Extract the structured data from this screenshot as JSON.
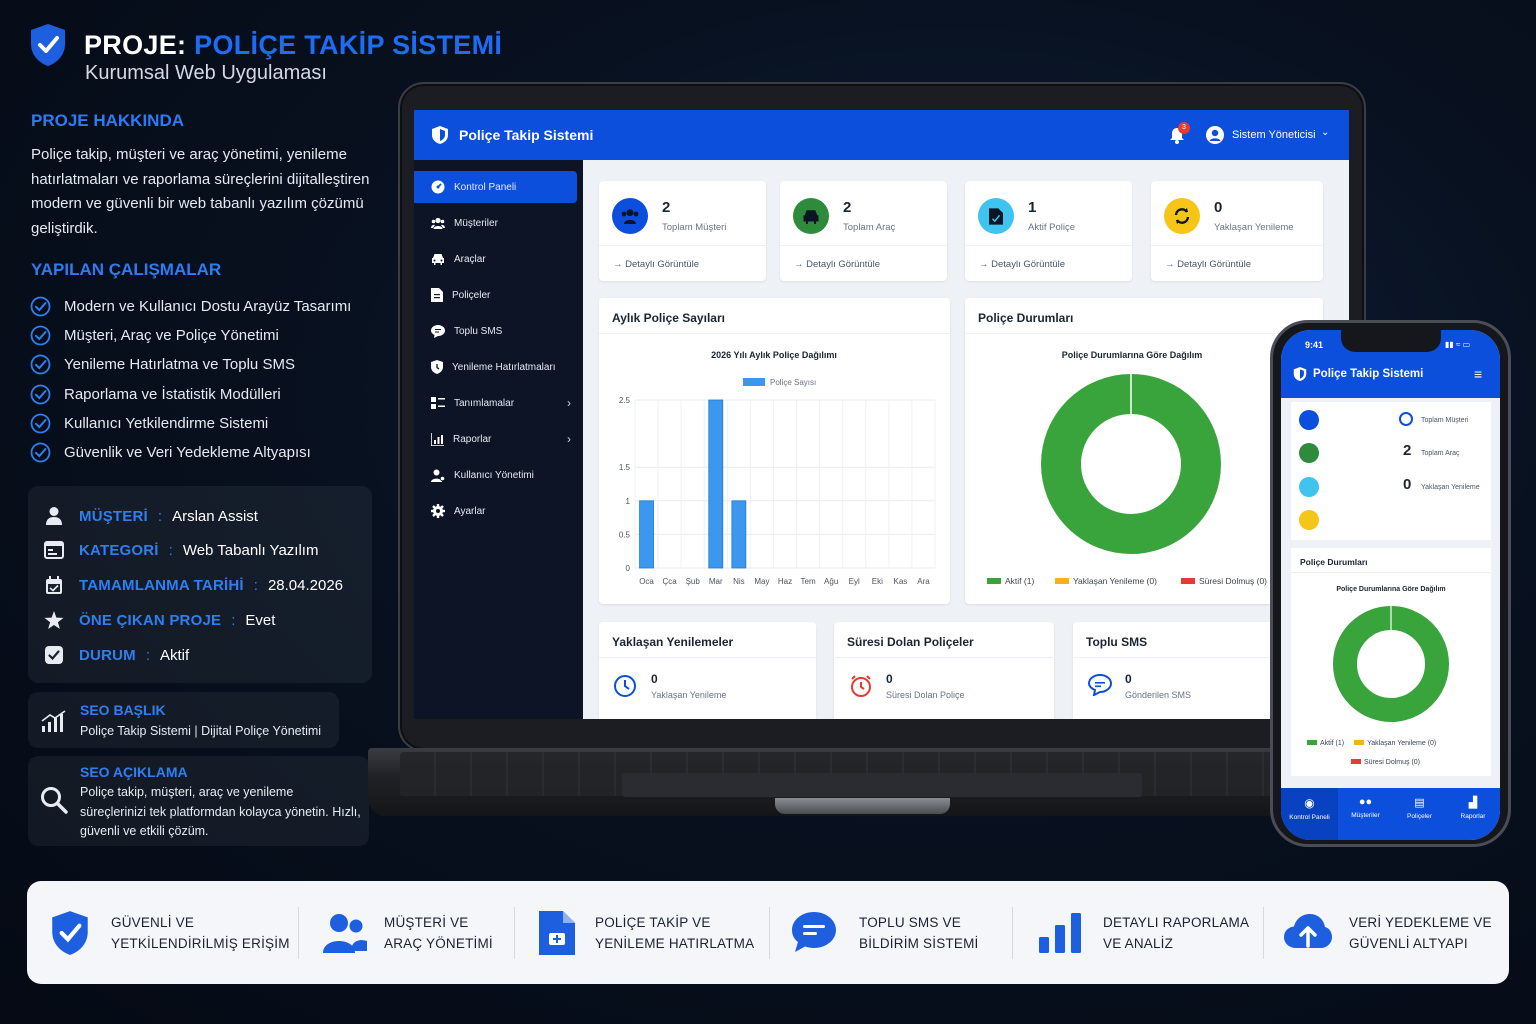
{
  "header": {
    "title_prefix": "PROJE:",
    "title_main": "POLİÇE TAKİP SİSTEMİ",
    "subtitle": "Kurumsal Web Uygulaması"
  },
  "about": {
    "heading": "PROJE HAKKINDA",
    "text": "Poliçe takip, müşteri ve araç yönetimi, yenileme hatırlatmaları ve raporlama süreçlerini dijitalleştiren modern ve güvenli bir web tabanlı yazılım çözümü geliştirdik."
  },
  "works": {
    "heading": "YAPILAN ÇALIŞMALAR",
    "items": [
      "Modern ve Kullanıcı Dostu Arayüz Tasarımı",
      "Müşteri, Araç ve Poliçe Yönetimi",
      "Yenileme Hatırlatma ve Toplu SMS",
      "Raporlama ve İstatistik Modülleri",
      "Kullanıcı Yetkilendirme Sistemi",
      "Güvenlik ve Veri Yedekleme Altyapısı"
    ]
  },
  "info": [
    {
      "label": "MÜŞTERİ",
      "value": "Arslan Assist",
      "icon": "person-icon"
    },
    {
      "label": "KATEGORİ",
      "value": "Web Tabanlı Yazılım",
      "icon": "browser-icon"
    },
    {
      "label": "TAMAMLANMA TARİHİ",
      "value": "28.04.2026",
      "icon": "calendar-icon"
    },
    {
      "label": "ÖNE ÇIKAN PROJE",
      "value": "Evet",
      "icon": "star-icon"
    },
    {
      "label": "DURUM",
      "value": "Aktif",
      "icon": "check-box-icon"
    }
  ],
  "seo": {
    "title_label": "SEO BAŞLIK",
    "title_value": "Poliçe Takip Sistemi | Dijital Poliçe Yönetimi",
    "desc_label": "SEO AÇIKLAMA",
    "desc_value": "Poliçe takip, müşteri, araç ve yenileme süreçlerinizi tek platformdan kolayca yönetin. Hızlı, güvenli ve etkili çözüm."
  },
  "app": {
    "brand": "Poliçe Takip Sistemi",
    "notif_count": "3",
    "user": "Sistem Yöneticisi",
    "nav": [
      {
        "label": "Kontrol Paneli",
        "icon": "dashboard-icon",
        "active": true
      },
      {
        "label": "Müşteriler",
        "icon": "users-icon"
      },
      {
        "label": "Araçlar",
        "icon": "car-icon"
      },
      {
        "label": "Poliçeler",
        "icon": "document-icon"
      },
      {
        "label": "Toplu SMS",
        "icon": "chat-icon"
      },
      {
        "label": "Yenileme Hatırlatmaları",
        "icon": "reminder-icon"
      },
      {
        "label": "Tanımlamalar",
        "icon": "settings-list-icon",
        "chevron": true
      },
      {
        "label": "Raporlar",
        "icon": "report-icon",
        "chevron": true
      },
      {
        "label": "Kullanıcı Yönetimi",
        "icon": "user-manage-icon"
      },
      {
        "label": "Ayarlar",
        "icon": "gear-icon"
      }
    ],
    "stats": [
      {
        "value": "2",
        "label": "Toplam Müşteri",
        "link": "Detaylı Görüntüle",
        "color": "#0b4fdc"
      },
      {
        "value": "2",
        "label": "Toplam Araç",
        "link": "Detaylı Görüntüle",
        "color": "#2e8b3c"
      },
      {
        "value": "1",
        "label": "Aktif Poliçe",
        "link": "Detaylı Görüntüle",
        "color": "#3fc3ef"
      },
      {
        "value": "0",
        "label": "Yaklaşan Yenileme",
        "link": "Detaylı Görüntüle",
        "color": "#f5c518"
      }
    ],
    "monthly_panel_title": "Aylık Poliçe Sayıları",
    "status_panel_title": "Poliçe Durumları",
    "bottom": [
      {
        "title": "Yaklaşan Yenilemeler",
        "value": "0",
        "label": "Yaklaşan Yenileme",
        "icon": "clock-icon"
      },
      {
        "title": "Süresi Dolan Poliçeler",
        "value": "0",
        "label": "Süresi Dolan Poliçe",
        "icon": "alarm-icon"
      },
      {
        "title": "Toplu SMS",
        "value": "0",
        "label": "Gönderilen SMS",
        "icon": "sms-icon"
      }
    ]
  },
  "chart_data": [
    {
      "type": "bar",
      "title": "2026 Yılı Aylık Poliçe Dağılımı",
      "categories": [
        "Oca",
        "Çca",
        "Şub",
        "Mar",
        "Nis",
        "May",
        "Haz",
        "Tem",
        "Ağu",
        "Eyl",
        "Eki",
        "Kas",
        "Ara"
      ],
      "series": [
        {
          "name": "Poliçe Sayısı",
          "values": [
            1,
            0,
            0,
            2.5,
            1,
            0,
            0,
            0,
            0,
            0,
            0,
            0,
            0
          ]
        }
      ],
      "yticks": [
        "0",
        "0.5",
        "1",
        "1.5",
        "2.5"
      ],
      "ylim": [
        0,
        2.5
      ],
      "grid": true,
      "legend": "top"
    },
    {
      "type": "pie",
      "title": "Poliçe Durumlarına Göre Dağılım",
      "labels": [
        "Aktif (1)",
        "Yaklaşan Yenileme (0)",
        "Süresi Dolmuş (0)"
      ],
      "values": [
        1,
        0,
        0
      ],
      "colors": [
        "#3aa43c",
        "#f5b21a",
        "#e53b34"
      ],
      "legend": "bottom"
    }
  ],
  "phone": {
    "time": "9:41",
    "brand": "Poliçe Takip Sistemi",
    "stats": [
      {
        "value": "",
        "label": "Toplam Müşteri"
      },
      {
        "value": "2",
        "label": "Toplam Araç"
      },
      {
        "value": "0",
        "label": "Yaklaşan Yenileme"
      }
    ],
    "panel_title": "Poliçe Durumları",
    "chart_title": "Poliçe Durumlarına Göre Dağılım",
    "legend": [
      "Aktif (1)",
      "Yaklaşan Yenileme (0)",
      "Süresi Dolmuş (0)"
    ],
    "tabs": [
      {
        "label": "Kontrol Paneli",
        "icon": "dashboard-icon"
      },
      {
        "label": "Müşteriler",
        "icon": "users-icon"
      },
      {
        "label": "Poliçeler",
        "icon": "document-icon"
      },
      {
        "label": "Raporlar",
        "icon": "report-icon"
      }
    ]
  },
  "features": [
    {
      "line1": "GÜVENLİ VE",
      "line2": "YETKİLENDİRİLMİŞ ERİŞİM",
      "icon": "shield-check-icon"
    },
    {
      "line1": "MÜŞTERİ VE",
      "line2": "ARAÇ YÖNETİMİ",
      "icon": "users-icon"
    },
    {
      "line1": "POLİÇE TAKİP VE",
      "line2": "YENİLEME HATIRLATMA",
      "icon": "document-icon"
    },
    {
      "line1": "TOPLU SMS VE",
      "line2": "BİLDİRİM SİSTEMİ",
      "icon": "chat-icon"
    },
    {
      "line1": "DETAYLI RAPORLAMA",
      "line2": "VE ANALİZ",
      "icon": "bar-chart-icon"
    },
    {
      "line1": "VERİ YEDEKLEME VE",
      "line2": "GÜVENLİ ALTYAPI",
      "icon": "cloud-upload-icon"
    }
  ]
}
